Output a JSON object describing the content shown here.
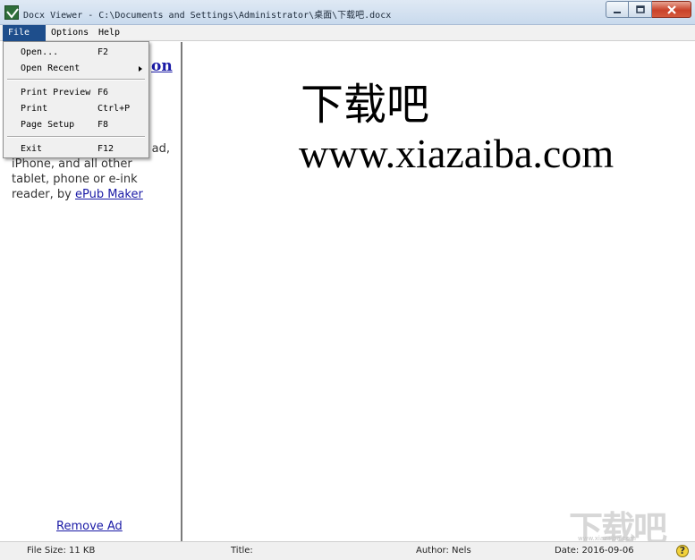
{
  "window": {
    "title": "Docx Viewer - C:\\Documents and Settings\\Administrator\\桌面\\下载吧.docx"
  },
  "menubar": {
    "items": [
      {
        "label": "File",
        "accel": "F"
      },
      {
        "label": "Options",
        "accel": "O"
      },
      {
        "label": "Help",
        "accel": "H"
      }
    ]
  },
  "file_menu": {
    "items": [
      {
        "label": "Open...",
        "shortcut": "F2"
      },
      {
        "label": "Open Recent",
        "shortcut": ""
      },
      {
        "label": "Print Preview",
        "shortcut": "F6"
      },
      {
        "label": "Print",
        "shortcut": "Ctrl+P"
      },
      {
        "label": "Page Setup",
        "shortcut": "F8"
      },
      {
        "label": "Exit",
        "shortcut": "F12"
      }
    ]
  },
  "ad_panel": {
    "heading_fragment": "on",
    "line1_fragment": "ad,",
    "line2": "iPhone, and all other",
    "line3": "tablet, phone or e-ink",
    "line4_prefix": "reader, by ",
    "line4_link": "ePub Maker",
    "remove_ad": "Remove Ad"
  },
  "document": {
    "line1": "下载吧",
    "line2": "www.xiazaiba.com"
  },
  "statusbar": {
    "file_size": "File Size: 11 KB",
    "title": "Title:",
    "author": "Author: Nels",
    "date": "Date: 2016-09-06"
  },
  "icons": {
    "app": "docx-viewer-icon",
    "help": "help-icon"
  }
}
